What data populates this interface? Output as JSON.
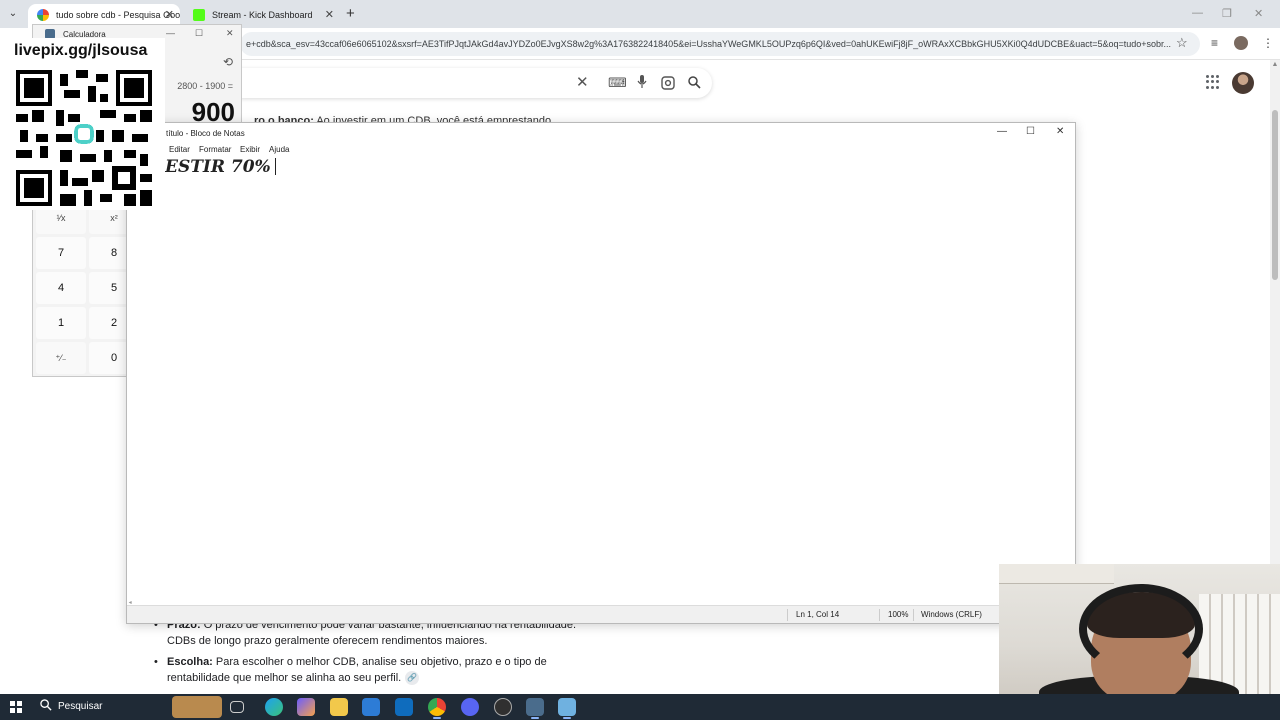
{
  "browser": {
    "tabs": [
      {
        "title": "tudo sobre cdb - Pesquisa Goo",
        "favicon": "google-icon",
        "active": true
      },
      {
        "title": "Stream - Kick Dashboard",
        "favicon": "kick-icon",
        "active": false
      }
    ],
    "url": "e+cdb&sca_esv=43ccaf06e6065102&sxsrf=AE3TifPJqtJAkGd4avJYDZo0EJvgXS8w2g%3A1763822418405&ei=UsshaYWeGMKL5OUPzq6p6QI&ved=0ahUKEwiFj8jF_oWRAxXCBbkGHU5XKi0Q4dUDCBE&uact=5&oq=tudo+sobr...",
    "behind_text_bold": "ro o banco:",
    "behind_text": "Ao investir em um CDB, você está emprestando",
    "colors": {
      "google_blue": "#4285f4",
      "kick_green": "#53fc18"
    }
  },
  "article": {
    "items": [
      {
        "bold": "Prazo:",
        "text": "O prazo de vencimento pode variar bastante, influenciando na rentabilidade. CDBs de longo prazo geralmente oferecem rendimentos maiores."
      },
      {
        "bold": "Escolha:",
        "text": "Para escolher o melhor CDB, analise seu objetivo, prazo e o tipo de rentabilidade que melhor se alinha ao seu perfil."
      }
    ]
  },
  "calculator": {
    "title": "Calculadora",
    "expression": "2800 - 1900 =",
    "result": "900",
    "keys": {
      "reciprocal": "¹⁄x",
      "square": "x²",
      "k7": "7",
      "k8": "8",
      "k4": "4",
      "k5": "5",
      "k1": "1",
      "k2": "2",
      "negate": "⁺⁄₋",
      "k0": "0"
    }
  },
  "overlay": {
    "url": "livepix.gg/jlsousa",
    "qr_accent": "#4dd0c8"
  },
  "notepad": {
    "title": "título - Bloco de Notas",
    "menu": [
      "Editar",
      "Formatar",
      "Exibir",
      "Ajuda"
    ],
    "content": "ESTIR 70%",
    "status": {
      "position": "Ln 1, Col 14",
      "zoom": "100%",
      "line_endings": "Windows (CRLF)"
    }
  },
  "taskbar": {
    "search_label": "Pesquisar",
    "apps": [
      "widgets",
      "task-view",
      "edge-icon",
      "copilot-icon",
      "file-explorer-icon",
      "store-icon",
      "mail-icon",
      "chrome-icon",
      "discord-icon",
      "obs-icon",
      "calculator-icon",
      "notepad-icon"
    ]
  }
}
